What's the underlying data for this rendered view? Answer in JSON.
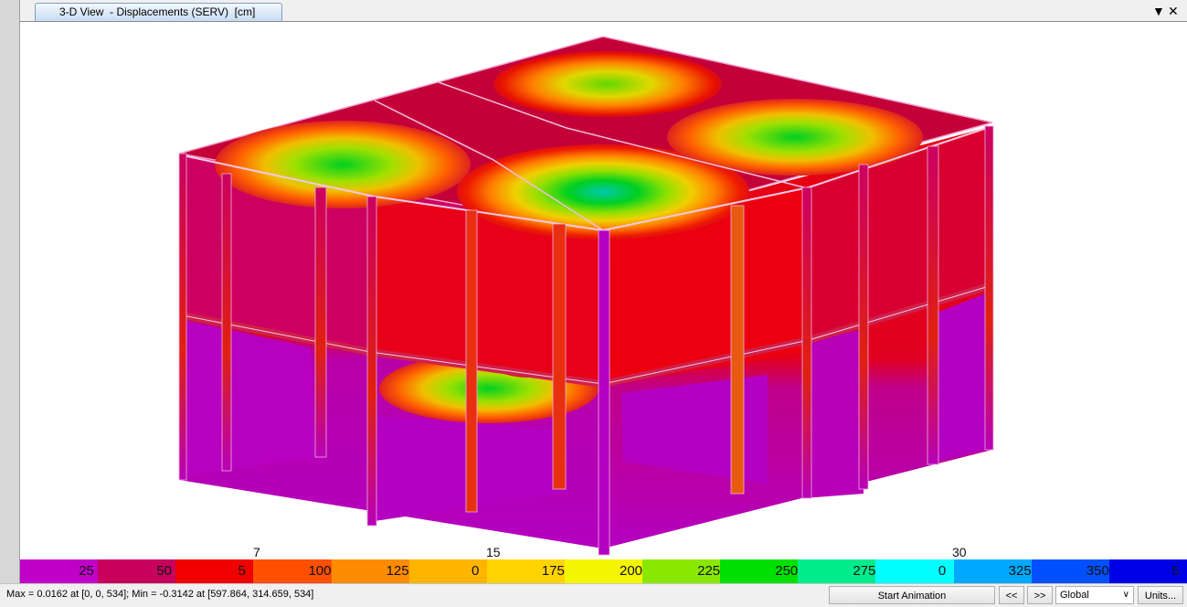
{
  "tab": {
    "title": "3-D View  - Displacements (SERV)  [cm]",
    "menu_glyph": "▼",
    "close_glyph": "✕"
  },
  "legend": {
    "stops": [
      {
        "color": "#c000c8",
        "label": "25"
      },
      {
        "color": "#c8005e",
        "label": "50"
      },
      {
        "color": "#f00000",
        "label": "5"
      },
      {
        "color": "#ff5000",
        "label": "100"
      },
      {
        "color": "#ff8c00",
        "label": "125"
      },
      {
        "color": "#ffb400",
        "label": "0"
      },
      {
        "color": "#ffd400",
        "label": "175"
      },
      {
        "color": "#f5f500",
        "label": "200"
      },
      {
        "color": "#8ae800",
        "label": "225"
      },
      {
        "color": "#00e000",
        "label": "250"
      },
      {
        "color": "#00ec8c",
        "label": "275"
      },
      {
        "color": "#00ffff",
        "label": "0"
      },
      {
        "color": "#00a8ff",
        "label": "325"
      },
      {
        "color": "#0050ff",
        "label": "350"
      },
      {
        "color": "#0000e6",
        "label": "5"
      }
    ],
    "top_labels": [
      "7",
      "15",
      "30"
    ]
  },
  "status": {
    "text": "Max = 0.0162 at [0, 0, 534];  Min = -0.3142 at [597.864, 314.659, 534]"
  },
  "toolbar": {
    "start_animation": "Start Animation",
    "prev": "<<",
    "next": ">>",
    "coord_system": "Global",
    "units": "Units..."
  },
  "colors": {
    "magenta": "#c000c8",
    "crimson": "#cc0058",
    "red": "#ee0000",
    "green": "#00d020",
    "cyan": "#00d8d8"
  }
}
